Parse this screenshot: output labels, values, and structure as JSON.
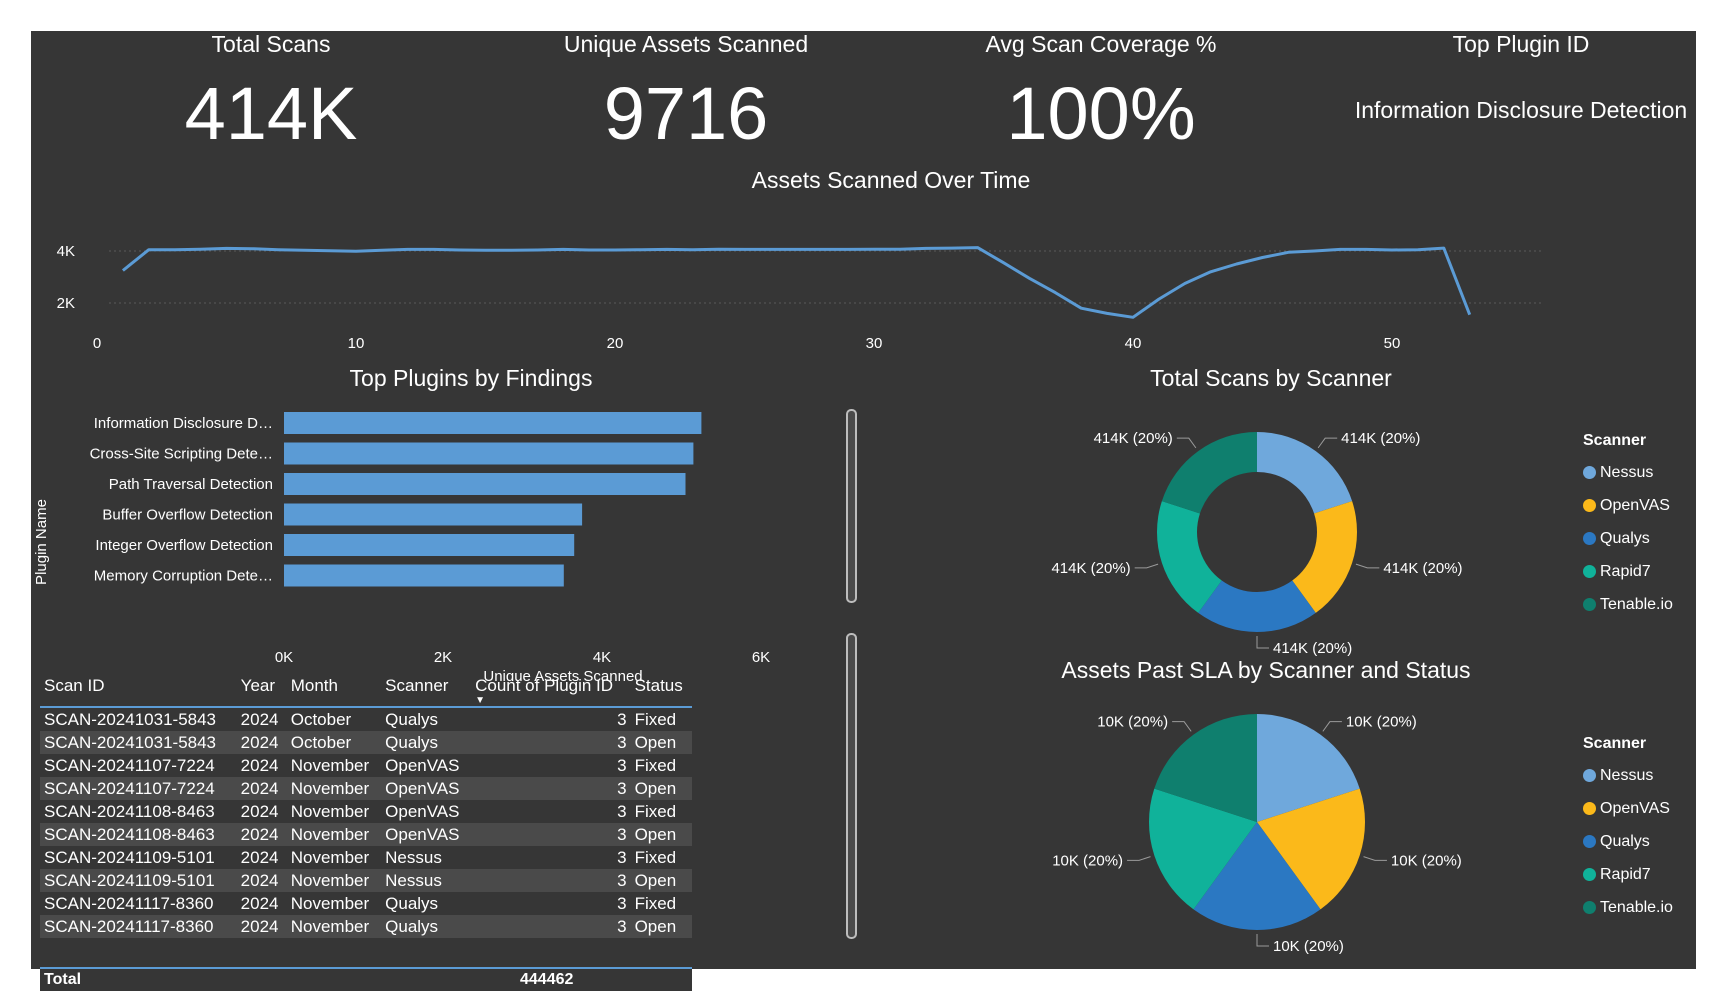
{
  "kpis": {
    "total_scans": {
      "title": "Total Scans",
      "value": "414K"
    },
    "unique_assets": {
      "title": "Unique Assets Scanned",
      "value": "9716"
    },
    "avg_coverage": {
      "title": "Avg Scan Coverage %",
      "value": "100%"
    },
    "top_plugin": {
      "title": "Top Plugin ID",
      "value": "Information Disclosure Detection"
    }
  },
  "chart_data": [
    {
      "type": "line",
      "title": "Assets Scanned Over Time",
      "xlabel": "",
      "ylabel": "",
      "x": [
        1,
        2,
        3,
        4,
        5,
        6,
        7,
        8,
        9,
        10,
        11,
        12,
        13,
        14,
        15,
        16,
        17,
        18,
        19,
        20,
        21,
        22,
        23,
        24,
        25,
        26,
        27,
        28,
        29,
        30,
        31,
        32,
        33,
        34,
        35,
        36,
        37,
        38,
        39,
        40,
        41,
        42,
        43,
        44,
        45,
        46,
        47,
        48,
        49,
        50,
        51,
        52,
        53
      ],
      "series": [
        {
          "values": [
            3250,
            4050,
            4050,
            4070,
            4100,
            4090,
            4050,
            4030,
            4010,
            3990,
            4030,
            4060,
            4060,
            4040,
            4030,
            4030,
            4040,
            4060,
            4040,
            4040,
            4050,
            4060,
            4050,
            4070,
            4060,
            4060,
            4060,
            4060,
            4060,
            4070,
            4070,
            4100,
            4110,
            4130,
            3550,
            2950,
            2400,
            1800,
            1600,
            1450,
            2150,
            2750,
            3200,
            3500,
            3750,
            3950,
            4000,
            4060,
            4060,
            4040,
            4050,
            4110,
            1550
          ]
        }
      ],
      "xlim": [
        0,
        55
      ],
      "ylim": [
        1000,
        4600
      ],
      "xticks": [
        "0",
        "10",
        "20",
        "30",
        "40",
        "50"
      ],
      "yticks": [
        "2K",
        "4K"
      ],
      "grid": true,
      "color": "#5b9bd5"
    },
    {
      "type": "bar",
      "orientation": "horizontal",
      "title": "Top Plugins by Findings",
      "xlabel": "Unique Assets Scanned",
      "ylabel": "Plugin Name",
      "categories": [
        "Information Disclosure D…",
        "Cross-Site Scripting Dete…",
        "Path Traversal Detection",
        "Buffer Overflow Detection",
        "Integer Overflow Detection",
        "Memory Corruption Dete…"
      ],
      "values": [
        5250,
        5150,
        5050,
        3750,
        3650,
        3520
      ],
      "xlim": [
        0,
        6000
      ],
      "xticks": [
        "0K",
        "2K",
        "4K",
        "6K"
      ],
      "color": "#5b9bd5"
    },
    {
      "type": "pie",
      "variant": "donut",
      "title": "Total Scans by Scanner",
      "categories": [
        "Nessus",
        "OpenVAS",
        "Qualys",
        "Rapid7",
        "Tenable.io"
      ],
      "values": [
        20,
        20,
        20,
        20,
        20
      ],
      "labels": [
        "414K (20%)",
        "414K (20%)",
        "414K (20%)",
        "414K (20%)",
        "414K (20%)"
      ],
      "legend_title": "Scanner",
      "legend_position": "right"
    },
    {
      "type": "pie",
      "title": "Assets Past SLA by Scanner and Status",
      "categories": [
        "Nessus",
        "OpenVAS",
        "Qualys",
        "Rapid7",
        "Tenable.io"
      ],
      "values": [
        20,
        20,
        20,
        20,
        20
      ],
      "labels": [
        "10K (20%)",
        "10K (20%)",
        "10K (20%)",
        "10K (20%)",
        "10K (20%)"
      ],
      "legend_title": "Scanner",
      "legend_position": "right"
    }
  ],
  "colors": {
    "Nessus": "#6fa8dc",
    "OpenVAS": "#fbb91a",
    "Qualys": "#2b78c2",
    "Rapid7": "#10b29a",
    "Tenable.io": "#0f7f6e",
    "background": "#363636"
  },
  "table": {
    "headers": [
      "Scan ID",
      "Year",
      "Month",
      "Scanner",
      "Count of Plugin ID",
      "Status"
    ],
    "sort_column": "Count of Plugin ID",
    "sort_icon": "sort-down-icon",
    "rows": [
      [
        "SCAN-20241031-5843",
        "2024",
        "October",
        "Qualys",
        "3",
        "Fixed"
      ],
      [
        "SCAN-20241031-5843",
        "2024",
        "October",
        "Qualys",
        "3",
        "Open"
      ],
      [
        "SCAN-20241107-7224",
        "2024",
        "November",
        "OpenVAS",
        "3",
        "Fixed"
      ],
      [
        "SCAN-20241107-7224",
        "2024",
        "November",
        "OpenVAS",
        "3",
        "Open"
      ],
      [
        "SCAN-20241108-8463",
        "2024",
        "November",
        "OpenVAS",
        "3",
        "Fixed"
      ],
      [
        "SCAN-20241108-8463",
        "2024",
        "November",
        "OpenVAS",
        "3",
        "Open"
      ],
      [
        "SCAN-20241109-5101",
        "2024",
        "November",
        "Nessus",
        "3",
        "Fixed"
      ],
      [
        "SCAN-20241109-5101",
        "2024",
        "November",
        "Nessus",
        "3",
        "Open"
      ],
      [
        "SCAN-20241117-8360",
        "2024",
        "November",
        "Qualys",
        "3",
        "Fixed"
      ],
      [
        "SCAN-20241117-8360",
        "2024",
        "November",
        "Qualys",
        "3",
        "Open"
      ]
    ],
    "total_label": "Total",
    "total_value": "444462"
  }
}
